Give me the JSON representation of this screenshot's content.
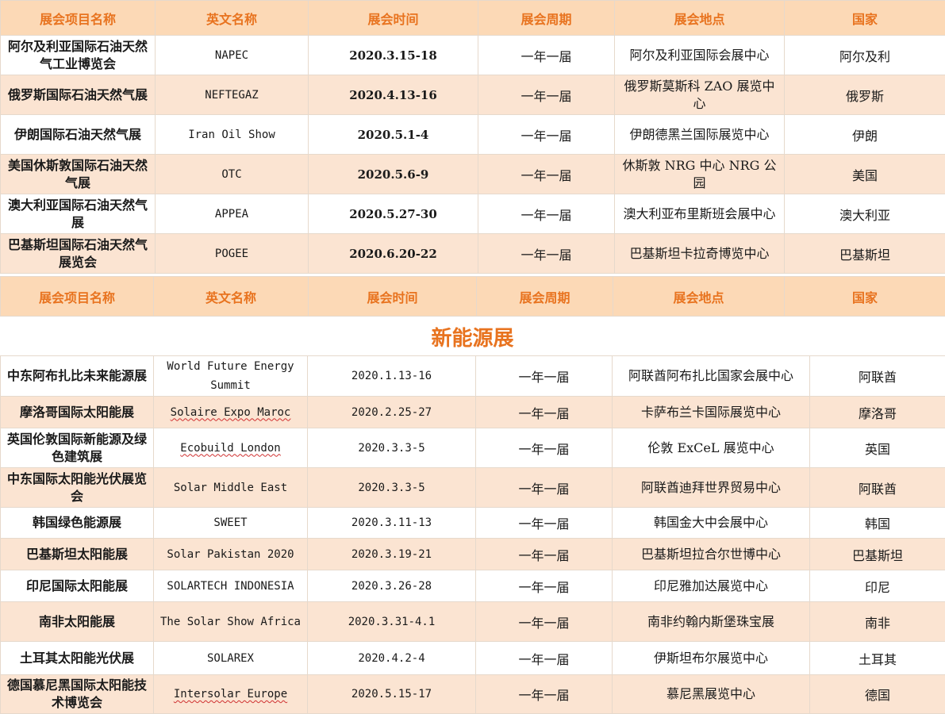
{
  "headers": [
    "展会项目名称",
    "英文名称",
    "展会时间",
    "展会周期",
    "展会地点",
    "国家"
  ],
  "section_title": "新能源展",
  "oil_gas": [
    {
      "name": "阿尔及利亚国际石油天然气工业博览会",
      "en": "NAPEC",
      "date": "2020.3.15-18",
      "cycle": "一年一届",
      "venue": "阿尔及利亚国际会展中心",
      "country": "阿尔及利"
    },
    {
      "name": "俄罗斯国际石油天然气展",
      "en": "NEFTEGAZ",
      "date": "2020.4.13-16",
      "cycle": "一年一届",
      "venue": "俄罗斯莫斯科 ZAO 展览中心",
      "country": "俄罗斯"
    },
    {
      "name": "伊朗国际石油天然气展",
      "en": "Iran Oil Show",
      "date": "2020.5.1-4",
      "cycle": "一年一届",
      "venue": "伊朗德黑兰国际展览中心",
      "country": "伊朗"
    },
    {
      "name": "美国休斯敦国际石油天然气展",
      "en": "OTC",
      "date": "2020.5.6-9",
      "cycle": "一年一届",
      "venue": "休斯敦 NRG 中心 NRG 公园",
      "country": "美国"
    },
    {
      "name": "澳大利亚国际石油天然气展",
      "en": "APPEA",
      "date": "2020.5.27-30",
      "cycle": "一年一届",
      "venue": "澳大利亚布里斯班会展中心",
      "country": "澳大利亚"
    },
    {
      "name": "巴基斯坦国际石油天然气展览会",
      "en": "POGEE",
      "date": "2020.6.20-22",
      "cycle": "一年一届",
      "venue": "巴基斯坦卡拉奇博览中心",
      "country": "巴基斯坦"
    }
  ],
  "new_energy": [
    {
      "name": "中东阿布扎比未来能源展",
      "en": "World Future Energy Summit",
      "date": "2020.1.13-16",
      "cycle": "一年一届",
      "venue": "阿联酋阿布扎比国家会展中心",
      "country": "阿联酋"
    },
    {
      "name": "摩洛哥国际太阳能展",
      "en": "Solaire Expo Maroc",
      "date": "2020.2.25-27",
      "cycle": "一年一届",
      "venue": "卡萨布兰卡国际展览中心",
      "country": "摩洛哥"
    },
    {
      "name": "英国伦敦国际新能源及绿色建筑展",
      "en": "Ecobuild London",
      "date": "2020.3.3-5",
      "cycle": "一年一届",
      "venue": "伦敦 ExCeL 展览中心",
      "country": "英国"
    },
    {
      "name": "中东国际太阳能光伏展览会",
      "en": "Solar Middle East",
      "date": "2020.3.3-5",
      "cycle": "一年一届",
      "venue": "阿联酋迪拜世界贸易中心",
      "country": "阿联酋"
    },
    {
      "name": "韩国绿色能源展",
      "en": "SWEET",
      "date": "2020.3.11-13",
      "cycle": "一年一届",
      "venue": "韩国金大中会展中心",
      "country": "韩国"
    },
    {
      "name": "巴基斯坦太阳能展",
      "en": "Solar Pakistan 2020",
      "date": "2020.3.19-21",
      "cycle": "一年一届",
      "venue": "巴基斯坦拉合尔世博中心",
      "country": "巴基斯坦"
    },
    {
      "name": "印尼国际太阳能展",
      "en": "SOLARTECH INDONESIA",
      "date": "2020.3.26-28",
      "cycle": "一年一届",
      "venue": "印尼雅加达展览中心",
      "country": "印尼"
    },
    {
      "name": "南非太阳能展",
      "en": "The  Solar  Show Africa",
      "date": "2020.3.31-4.1",
      "cycle": "一年一届",
      "venue": "南非约翰内斯堡珠宝展",
      "country": "南非"
    },
    {
      "name": "土耳其太阳能光伏展",
      "en": "SOLAREX",
      "date": "2020.4.2-4",
      "cycle": "一年一届",
      "venue": "伊斯坦布尔展览中心",
      "country": "土耳其"
    },
    {
      "name": "德国慕尼黑国际太阳能技术博览会",
      "en": "Intersolar Europe",
      "date": "2020.5.15-17",
      "cycle": "一年一届",
      "venue": "慕尼黑展览中心",
      "country": "德国"
    }
  ]
}
